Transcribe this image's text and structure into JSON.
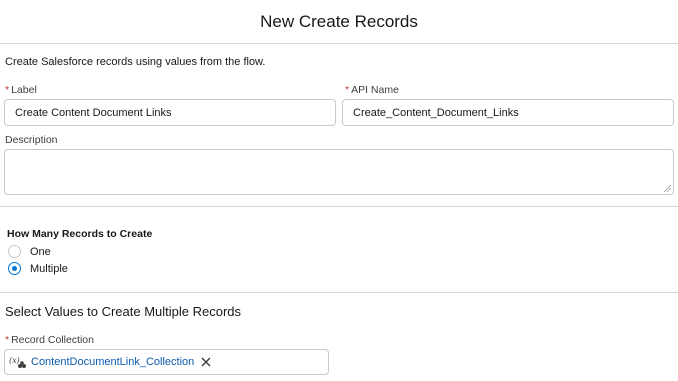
{
  "header": {
    "title": "New Create Records"
  },
  "intro": {
    "text": "Create Salesforce records using values from the flow."
  },
  "form": {
    "label": {
      "required_mark": "*",
      "label": "Label",
      "value": "Create Content Document Links"
    },
    "api_name": {
      "required_mark": "*",
      "label": "API Name",
      "value": "Create_Content_Document_Links"
    },
    "description": {
      "label": "Description",
      "value": ""
    }
  },
  "how_many": {
    "label": "How Many Records to Create",
    "options": [
      {
        "label": "One",
        "checked": false
      },
      {
        "label": "Multiple",
        "checked": true
      }
    ]
  },
  "multiple_section": {
    "heading": "Select Values to Create Multiple Records",
    "record_collection": {
      "required_mark": "*",
      "label": "Record Collection",
      "pill": {
        "icon": "variable-icon",
        "label": "ContentDocumentLink_Collection"
      }
    }
  },
  "colors": {
    "accent": "#0176d3",
    "required": "#c23934",
    "pill_text": "#0b5cab",
    "border": "#c9c9c9"
  }
}
